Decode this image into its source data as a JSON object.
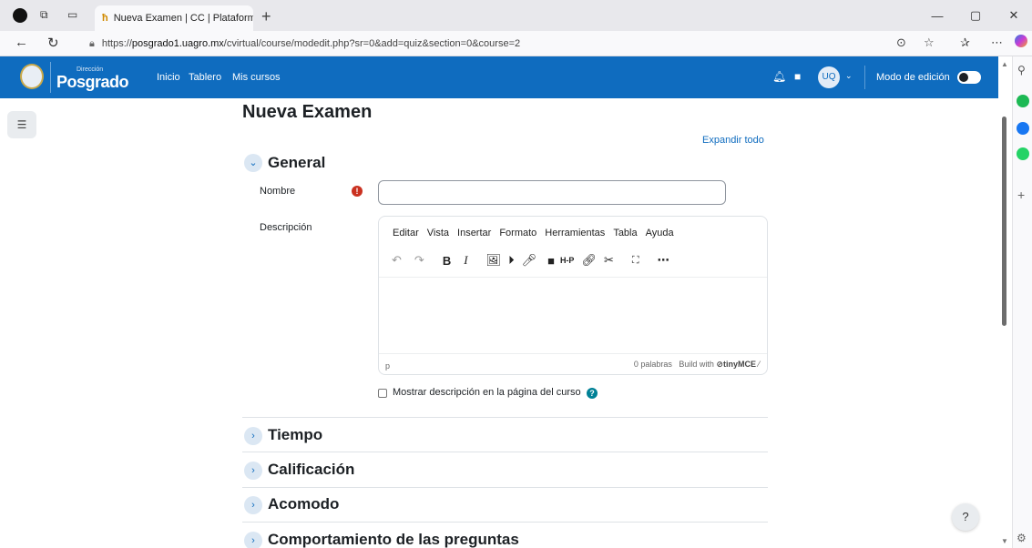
{
  "browser": {
    "tab_title": "Nueva Examen | CC | Plataforma v",
    "tab_close": "×",
    "new_tab": "+",
    "url_prefix": "https://",
    "url_host": "posgrado1.uagro.mx",
    "url_path": "/cvirtual/course/modedit.php?sr=0&add=quiz&section=0&course=2",
    "window_controls": [
      "—",
      "▢",
      "✕"
    ]
  },
  "navbar": {
    "logo_small": "Dirección",
    "logo_main": "Posgrado",
    "links": [
      "Inicio",
      "Tablero",
      "Mis cursos"
    ],
    "avatar_initials": "UQ",
    "edit_mode_label": "Modo de edición",
    "colors": {
      "primary": "#0f6cbf"
    }
  },
  "page": {
    "title": "Nueva Examen",
    "expand_all": "Expandir todo"
  },
  "general": {
    "title": "General",
    "name_label": "Nombre",
    "description_label": "Descripción",
    "name_value": "",
    "required_icon": "!"
  },
  "editor": {
    "menu": [
      "Editar",
      "Vista",
      "Insertar",
      "Formato",
      "Herramientas",
      "Tabla",
      "Ayuda"
    ],
    "status_path": "p",
    "word_count": "0 palabras",
    "build_with": "Build with",
    "brand": "tinyMCE"
  },
  "checkbox": {
    "label": "Mostrar descripción en la página del curso",
    "checked": false
  },
  "sections": [
    {
      "title": "Tiempo"
    },
    {
      "title": "Calificación"
    },
    {
      "title": "Acomodo"
    },
    {
      "title": "Comportamiento de las preguntas"
    }
  ],
  "help_button": "?"
}
